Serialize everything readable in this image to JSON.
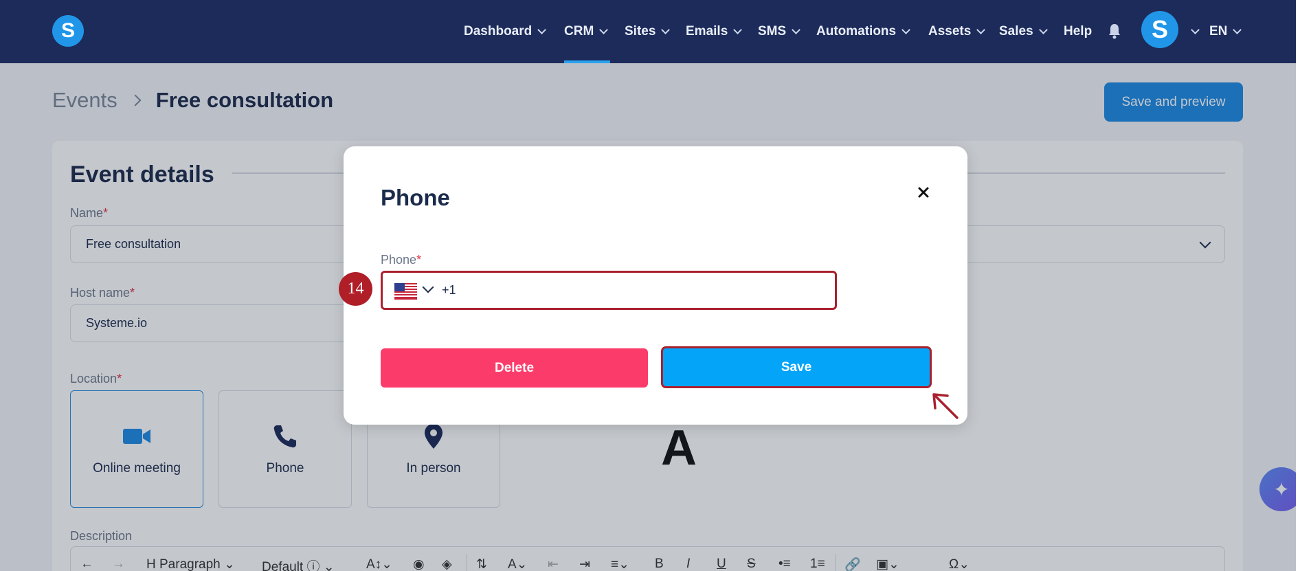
{
  "nav": {
    "items": [
      {
        "label": "Dashboard",
        "has_dropdown": true
      },
      {
        "label": "CRM",
        "has_dropdown": true,
        "active": true
      },
      {
        "label": "Sites",
        "has_dropdown": true
      },
      {
        "label": "Emails",
        "has_dropdown": true
      },
      {
        "label": "SMS",
        "has_dropdown": true
      },
      {
        "label": "Automations",
        "has_dropdown": true
      },
      {
        "label": "Assets",
        "has_dropdown": true
      },
      {
        "label": "Sales",
        "has_dropdown": true
      },
      {
        "label": "Help",
        "has_dropdown": false
      }
    ],
    "logo_letter": "S",
    "avatar_letter": "S",
    "language": "EN"
  },
  "breadcrumb": {
    "parent": "Events",
    "current": "Free consultation"
  },
  "header": {
    "save_preview_label": "Save and preview"
  },
  "event_details": {
    "title": "Event details",
    "name_label": "Name",
    "name_value": "Free consultation",
    "host_label": "Host name",
    "host_value": "Systeme.io",
    "location_label": "Location",
    "locations": [
      {
        "label": "Online meeting",
        "icon": "video-camera-icon",
        "selected": true
      },
      {
        "label": "Phone",
        "icon": "phone-icon",
        "selected": false
      },
      {
        "label": "In person",
        "icon": "map-pin-icon",
        "selected": false
      }
    ],
    "description_label": "Description",
    "editor_toolbar": {
      "paragraph_label": "Paragraph",
      "font_label": "Default"
    },
    "partial_letter": "A"
  },
  "modal": {
    "title": "Phone",
    "field_label": "Phone",
    "phone_value": "+1",
    "country_flag": "us-flag-icon",
    "delete_label": "Delete",
    "save_label": "Save"
  },
  "annotation": {
    "step_number": "14"
  },
  "colors": {
    "nav_bg": "#1c2b5a",
    "accent_blue": "#1b8ae4",
    "save_blue": "#04a5f8",
    "delete_pink": "#fb3c6b",
    "highlight_red": "#a9202e",
    "required_red": "#e0374e"
  }
}
